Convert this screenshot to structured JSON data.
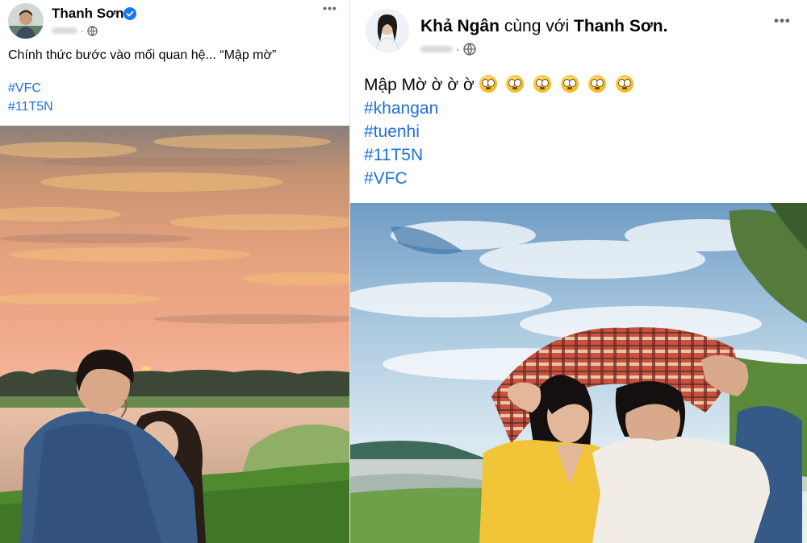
{
  "left_post": {
    "author": "Thanh Sơn",
    "verified": true,
    "caption": "Chính thức bước vào mối quan hệ... “Mập mờ”",
    "hashtags": [
      "#VFC",
      "#11T5N"
    ],
    "privacy_icon": "globe-icon",
    "menu_icon": "more-options-icon",
    "menu_label": "•••"
  },
  "right_post": {
    "author": "Khả Ngân",
    "with_text": "cùng với",
    "tagged": "Thanh Sơn.",
    "caption": "Mập Mờ ờ ờ ờ",
    "emoji_name": "flushed-face-emoji",
    "emoji_count": 6,
    "hashtags": [
      "#khangan",
      "#tuenhi",
      "#11T5N",
      "#VFC"
    ],
    "privacy_icon": "globe-icon",
    "menu_icon": "more-options-icon",
    "menu_label": "•••"
  },
  "colors": {
    "link": "#216fdb",
    "verified": "#1877f2",
    "meta": "#65676b"
  }
}
